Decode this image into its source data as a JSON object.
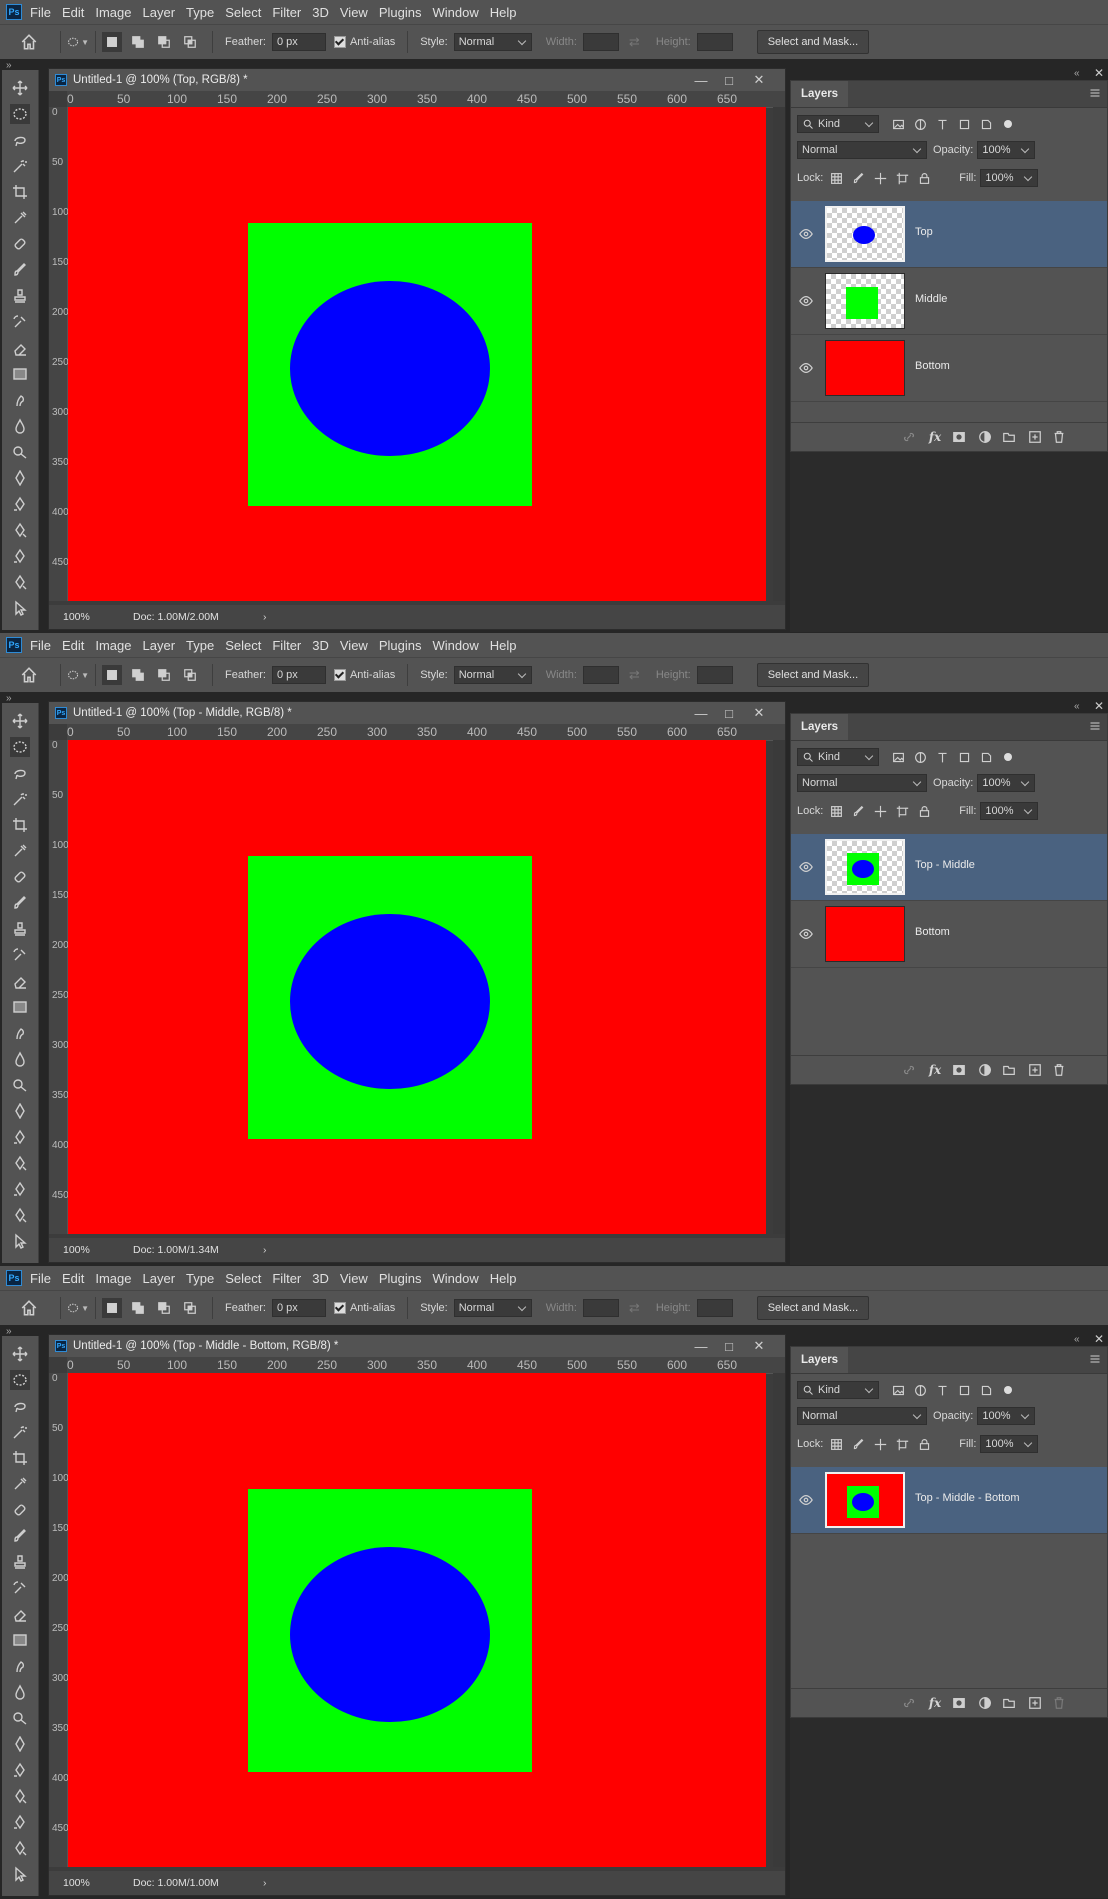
{
  "app": {
    "logo": "Ps"
  },
  "menu": [
    "File",
    "Edit",
    "Image",
    "Layer",
    "Type",
    "Select",
    "Filter",
    "3D",
    "View",
    "Plugins",
    "Window",
    "Help"
  ],
  "options": {
    "feather_label": "Feather:",
    "feather_value": "0 px",
    "antialias_label": "Anti-alias",
    "style_label": "Style:",
    "style_value": "Normal",
    "width_label": "Width:",
    "height_label": "Height:",
    "mask_button": "Select and Mask..."
  },
  "ruler": {
    "h_ticks": [
      "0",
      "50",
      "100",
      "150",
      "200",
      "250",
      "300",
      "350",
      "400",
      "450",
      "500",
      "550",
      "600",
      "650"
    ]
  },
  "layers_panel": {
    "tab": "Layers",
    "filter_kind": "Kind",
    "blend_mode": "Normal",
    "opacity_label": "Opacity:",
    "opacity_value": "100%",
    "lock_label": "Lock:",
    "fill_label": "Fill:",
    "fill_value": "100%"
  },
  "colors": {
    "red": "#ff0000",
    "green": "#00ff00",
    "blue": "#0000ff",
    "selected_layer": "#4a6280"
  },
  "frames": [
    {
      "doc_title": "Untitled-1 @ 100% (Top, RGB/8) *",
      "zoom": "100%",
      "doc_info": "Doc: 1.00M/2.00M",
      "layers": [
        {
          "name": "Top",
          "selected": true,
          "thumb": "circle"
        },
        {
          "name": "Middle",
          "selected": false,
          "thumb": "square"
        },
        {
          "name": "Bottom",
          "selected": false,
          "thumb": "red"
        }
      ]
    },
    {
      "doc_title": "Untitled-1 @ 100% (Top - Middle, RGB/8) *",
      "zoom": "100%",
      "doc_info": "Doc: 1.00M/1.34M",
      "layers": [
        {
          "name": "Top - Middle",
          "selected": true,
          "thumb": "square-circle"
        },
        {
          "name": "Bottom",
          "selected": false,
          "thumb": "red"
        }
      ]
    },
    {
      "doc_title": "Untitled-1 @ 100% (Top - Middle - Bottom, RGB/8) *",
      "zoom": "100%",
      "doc_info": "Doc: 1.00M/1.00M",
      "layers": [
        {
          "name": "Top - Middle - Bottom",
          "selected": true,
          "thumb": "all"
        }
      ]
    }
  ]
}
